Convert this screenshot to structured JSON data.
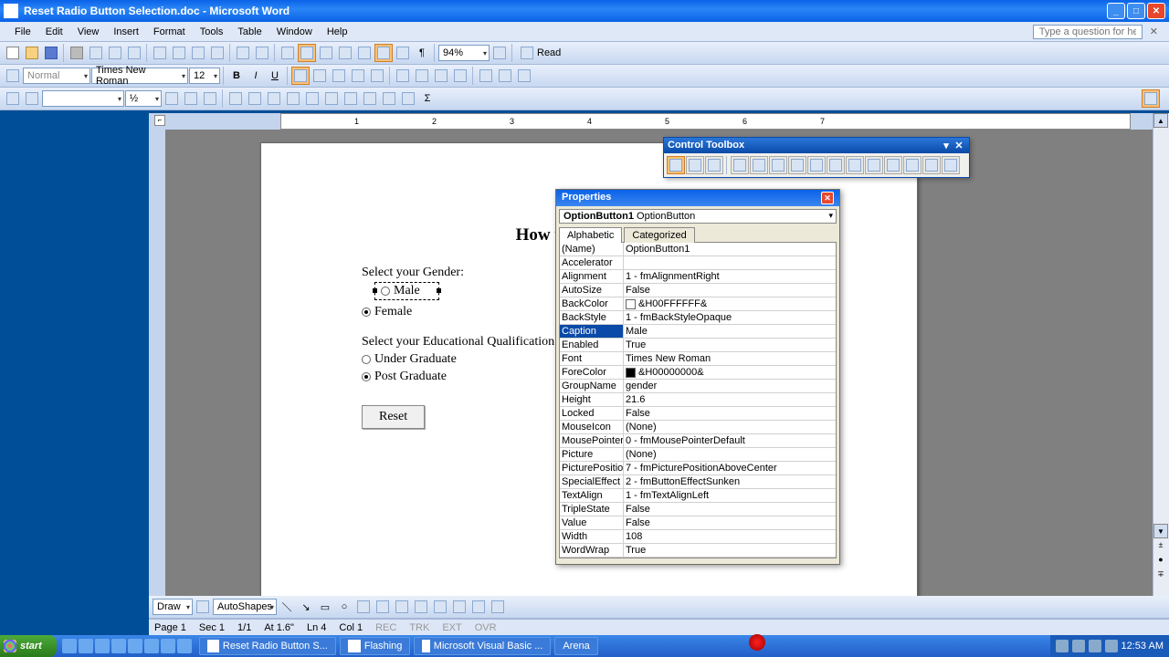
{
  "window": {
    "title": "Reset Radio Button Selection.doc - Microsoft Word"
  },
  "menus": [
    "File",
    "Edit",
    "View",
    "Insert",
    "Format",
    "Tools",
    "Table",
    "Window",
    "Help"
  ],
  "help_placeholder": "Type a question for help",
  "toolbar": {
    "zoom": "94%",
    "read": "Read",
    "style": "Normal",
    "font": "Times New Roman",
    "size": "12",
    "half": "½"
  },
  "ruler_marks": [
    "1",
    "2",
    "3",
    "4",
    "5",
    "6",
    "7"
  ],
  "document": {
    "title": "How to reset or clea",
    "gender_label": "Select your Gender:",
    "male": "Male",
    "female": "Female",
    "qual_label": "Select your Educational Qualification:",
    "ug": "Under Graduate",
    "pg": "Post Graduate",
    "reset": "Reset"
  },
  "control_toolbox": {
    "title": "Control Toolbox"
  },
  "properties": {
    "title": "Properties",
    "object_name": "OptionButton1",
    "object_type": "OptionButton",
    "tabs": [
      "Alphabetic",
      "Categorized"
    ],
    "selected_key": "Caption",
    "rows": [
      {
        "k": "(Name)",
        "v": "OptionButton1"
      },
      {
        "k": "Accelerator",
        "v": ""
      },
      {
        "k": "Alignment",
        "v": "1 - fmAlignmentRight"
      },
      {
        "k": "AutoSize",
        "v": "False"
      },
      {
        "k": "BackColor",
        "v": "&H00FFFFFF&",
        "sw": "#ffffff"
      },
      {
        "k": "BackStyle",
        "v": "1 - fmBackStyleOpaque"
      },
      {
        "k": "Caption",
        "v": "Male"
      },
      {
        "k": "Enabled",
        "v": "True"
      },
      {
        "k": "Font",
        "v": "Times New Roman"
      },
      {
        "k": "ForeColor",
        "v": "&H00000000&",
        "sw": "#000000"
      },
      {
        "k": "GroupName",
        "v": "gender"
      },
      {
        "k": "Height",
        "v": "21.6"
      },
      {
        "k": "Locked",
        "v": "False"
      },
      {
        "k": "MouseIcon",
        "v": "(None)"
      },
      {
        "k": "MousePointer",
        "v": "0 - fmMousePointerDefault"
      },
      {
        "k": "Picture",
        "v": "(None)"
      },
      {
        "k": "PicturePosition",
        "v": "7 - fmPicturePositionAboveCenter"
      },
      {
        "k": "SpecialEffect",
        "v": "2 - fmButtonEffectSunken"
      },
      {
        "k": "TextAlign",
        "v": "1 - fmTextAlignLeft"
      },
      {
        "k": "TripleState",
        "v": "False"
      },
      {
        "k": "Value",
        "v": "False"
      },
      {
        "k": "Width",
        "v": "108"
      },
      {
        "k": "WordWrap",
        "v": "True"
      }
    ]
  },
  "drawing": {
    "draw": "Draw",
    "autoshapes": "AutoShapes"
  },
  "status": {
    "page": "Page  1",
    "sec": "Sec 1",
    "pages": "1/1",
    "at": "At  1.6\"",
    "ln": "Ln  4",
    "col": "Col  1",
    "rec": "REC",
    "trk": "TRK",
    "ext": "EXT",
    "ovr": "OVR"
  },
  "taskbar": {
    "start": "start",
    "tasks": [
      "Reset Radio Button S...",
      "Flashing",
      "Microsoft Visual Basic ...",
      "Arena"
    ],
    "time": "12:53 AM"
  }
}
